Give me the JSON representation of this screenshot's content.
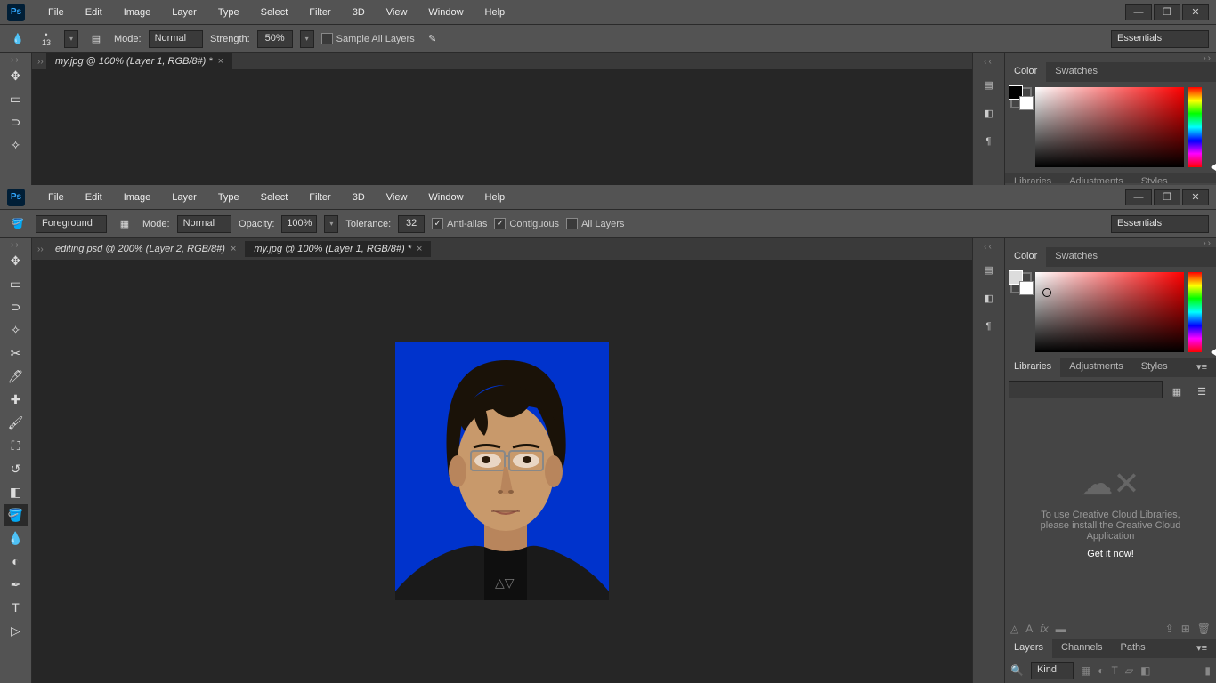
{
  "app": {
    "name": "Ps"
  },
  "menus": [
    "File",
    "Edit",
    "Image",
    "Layer",
    "Type",
    "Select",
    "Filter",
    "3D",
    "View",
    "Window",
    "Help"
  ],
  "workspace": "Essentials",
  "top_instance": {
    "tool": "blur",
    "options": {
      "brush_size": "13",
      "mode_label": "Mode:",
      "mode": "Normal",
      "strength_label": "Strength:",
      "strength": "50%",
      "sample_all": "Sample All Layers"
    },
    "tabs": [
      {
        "title": "my.jpg @ 100% (Layer 1, RGB/8#) *",
        "active": true
      }
    ],
    "color_panel": {
      "tabs": [
        "Color",
        "Swatches"
      ],
      "fg": "#000000",
      "bg": "#ffffff"
    },
    "hidden_tabs": [
      "Libraries",
      "Adjustments",
      "Styles"
    ]
  },
  "bottom_instance": {
    "tool": "paint-bucket",
    "options": {
      "fill_label": "Foreground",
      "mode_label": "Mode:",
      "mode": "Normal",
      "opacity_label": "Opacity:",
      "opacity": "100%",
      "tolerance_label": "Tolerance:",
      "tolerance": "32",
      "anti_alias": "Anti-alias",
      "contiguous": "Contiguous",
      "all_layers": "All Layers"
    },
    "tabs": [
      {
        "title": "editing.psd @ 200% (Layer 2, RGB/8#)",
        "active": false
      },
      {
        "title": "my.jpg @ 100% (Layer 1, RGB/8#) *",
        "active": true
      }
    ],
    "color_panel": {
      "tabs": [
        "Color",
        "Swatches"
      ],
      "fg": "#dcdcdc",
      "bg": "#ffffff"
    },
    "lib_panel": {
      "tabs": [
        "Libraries",
        "Adjustments",
        "Styles"
      ],
      "msg1": "To use Creative Cloud Libraries,",
      "msg2": "please install the Creative Cloud",
      "msg3": "Application",
      "link": "Get it now!"
    },
    "layers_tabs": [
      "Layers",
      "Channels",
      "Paths"
    ],
    "layers_filter": "Kind"
  }
}
